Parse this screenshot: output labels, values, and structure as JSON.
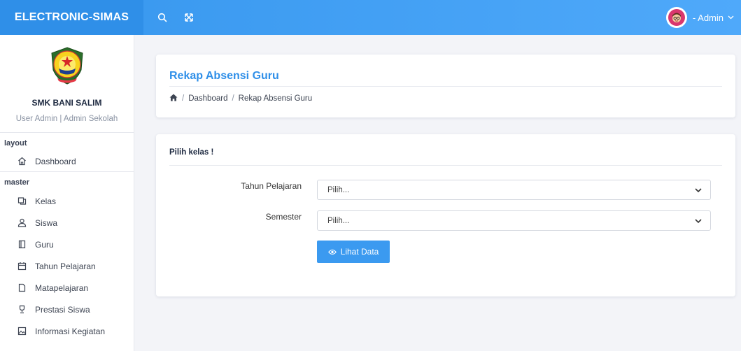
{
  "brand": {
    "name": "ELECTRONIC-SIMAS"
  },
  "topbar": {
    "search_icon": "search-icon",
    "fullscreen_icon": "fullscreen-icon",
    "user_label": "- Admin"
  },
  "sidebar": {
    "school_name": "SMK BANI SALIM",
    "school_role": "User Admin | Admin Sekolah",
    "sections": [
      {
        "label": "layout",
        "items": [
          {
            "label": "Dashboard",
            "icon": "home-icon"
          }
        ]
      },
      {
        "label": "master",
        "items": [
          {
            "label": "Kelas",
            "icon": "copy-icon"
          },
          {
            "label": "Siswa",
            "icon": "user-icon"
          },
          {
            "label": "Guru",
            "icon": "book-icon"
          },
          {
            "label": "Tahun Pelajaran",
            "icon": "calendar-icon"
          },
          {
            "label": "Matapelajaran",
            "icon": "file-icon"
          },
          {
            "label": "Prestasi Siswa",
            "icon": "trophy-icon"
          },
          {
            "label": "Informasi Kegiatan",
            "icon": "image-icon"
          }
        ]
      }
    ]
  },
  "page": {
    "title": "Rekap Absensi Guru",
    "breadcrumb": {
      "home_icon": "home-icon",
      "items": [
        "Dashboard",
        "Rekap Absensi Guru"
      ],
      "separator": "/"
    }
  },
  "form": {
    "title": "Pilih kelas !",
    "fields": [
      {
        "label": "Tahun Pelajaran",
        "value": "Pilih..."
      },
      {
        "label": "Semester",
        "value": "Pilih..."
      }
    ],
    "submit_label": "Lihat Data"
  },
  "colors": {
    "primary": "#2f8fe8",
    "navbar": "#4fa9fa",
    "background": "#f3f4f8"
  }
}
